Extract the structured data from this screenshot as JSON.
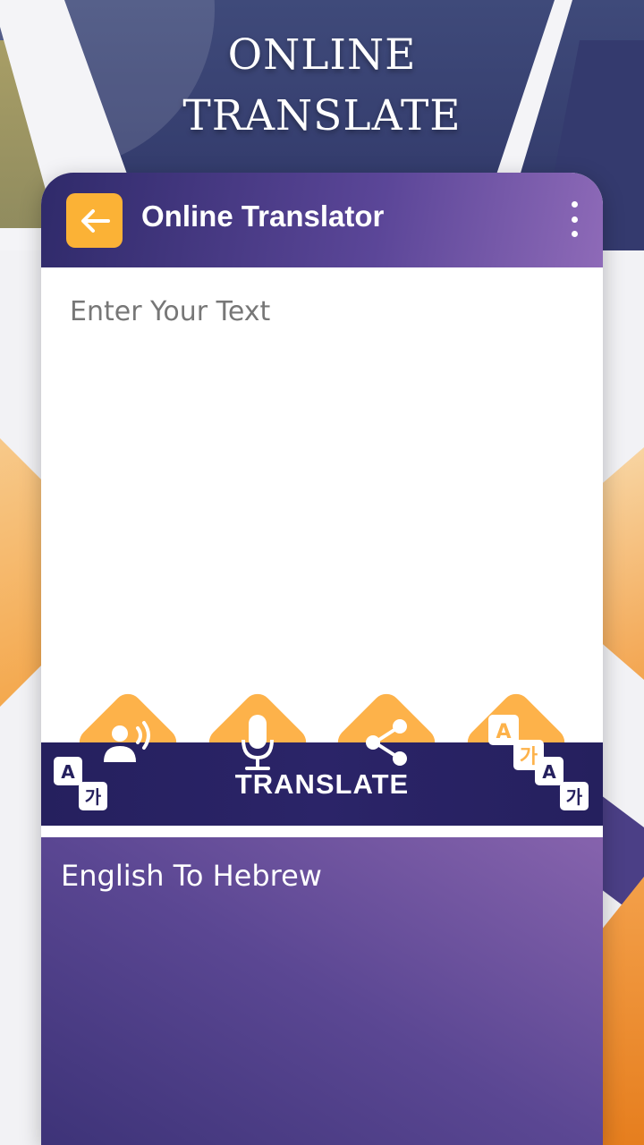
{
  "headline": {
    "line1": "ONLINE",
    "line2": "TRANSLATE"
  },
  "app_bar": {
    "title": "Online Translator"
  },
  "input": {
    "placeholder": "Enter Your Text"
  },
  "actions": [
    {
      "icon": "speaker-person-icon"
    },
    {
      "icon": "microphone-icon"
    },
    {
      "icon": "share-icon"
    },
    {
      "icon": "translate-icon"
    }
  ],
  "translate_bar": {
    "label": "TRANSLATE"
  },
  "output": {
    "language_pair": "English To Hebrew"
  },
  "colors": {
    "accent_orange": "#fdb24a",
    "back_button": "#fbb236",
    "bar_dark": "#25205e",
    "purple": "#5b4793"
  }
}
